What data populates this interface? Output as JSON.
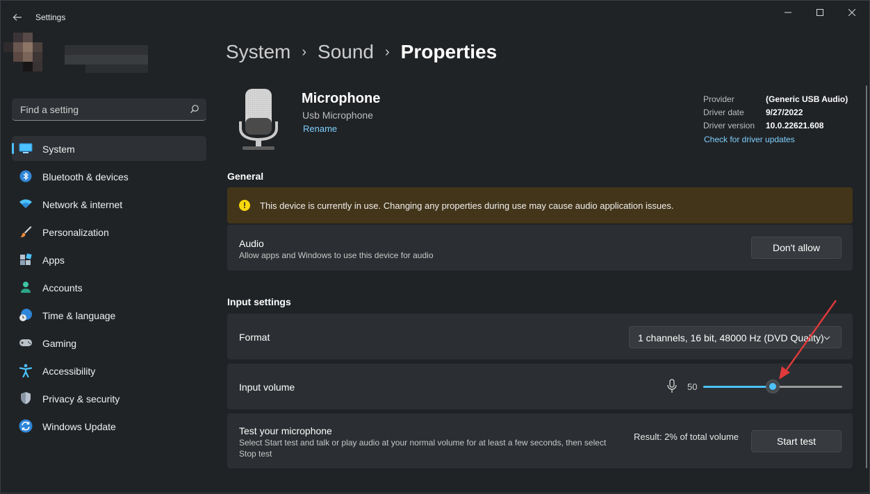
{
  "window": {
    "title": "Settings"
  },
  "search": {
    "placeholder": "Find a setting"
  },
  "sidebar": {
    "items": [
      {
        "label": "System",
        "icon": "system-icon",
        "active": true
      },
      {
        "label": "Bluetooth & devices",
        "icon": "bluetooth-icon"
      },
      {
        "label": "Network & internet",
        "icon": "wifi-icon"
      },
      {
        "label": "Personalization",
        "icon": "brush-icon"
      },
      {
        "label": "Apps",
        "icon": "apps-icon"
      },
      {
        "label": "Accounts",
        "icon": "account-icon"
      },
      {
        "label": "Time & language",
        "icon": "globe-clock-icon"
      },
      {
        "label": "Gaming",
        "icon": "gamepad-icon"
      },
      {
        "label": "Accessibility",
        "icon": "accessibility-icon"
      },
      {
        "label": "Privacy & security",
        "icon": "shield-icon"
      },
      {
        "label": "Windows Update",
        "icon": "update-icon"
      }
    ]
  },
  "breadcrumb": {
    "first": "System",
    "second": "Sound",
    "current": "Properties",
    "separator": "›"
  },
  "device": {
    "name": "Microphone",
    "subtitle": "Usb Microphone",
    "rename": "Rename",
    "driver": {
      "provider_label": "Provider",
      "provider": "(Generic USB Audio)",
      "date_label": "Driver date",
      "date": "9/27/2022",
      "version_label": "Driver version",
      "version": "10.0.22621.608",
      "update_link": "Check for driver updates"
    }
  },
  "general": {
    "heading": "General",
    "warning": "This device is currently in use. Changing any properties during use may cause audio application issues.",
    "audio_title": "Audio",
    "audio_desc": "Allow apps and Windows to use this device for audio",
    "audio_button": "Don't allow"
  },
  "input": {
    "heading": "Input settings",
    "format_title": "Format",
    "format_value": "1 channels, 16 bit, 48000 Hz (DVD Quality)",
    "volume_title": "Input volume",
    "volume_value": "50",
    "volume_fraction": 0.5,
    "test_title": "Test your microphone",
    "test_desc_line1": "Select Start test and talk or play audio at your normal volume for at least a few seconds, then select",
    "test_desc_line2": "Stop test",
    "test_result": "Result: 2% of total volume",
    "test_button": "Start test"
  },
  "colors": {
    "accent": "#4cc2ff",
    "warning_bg": "#433519",
    "annotation": "#e03a3a"
  }
}
